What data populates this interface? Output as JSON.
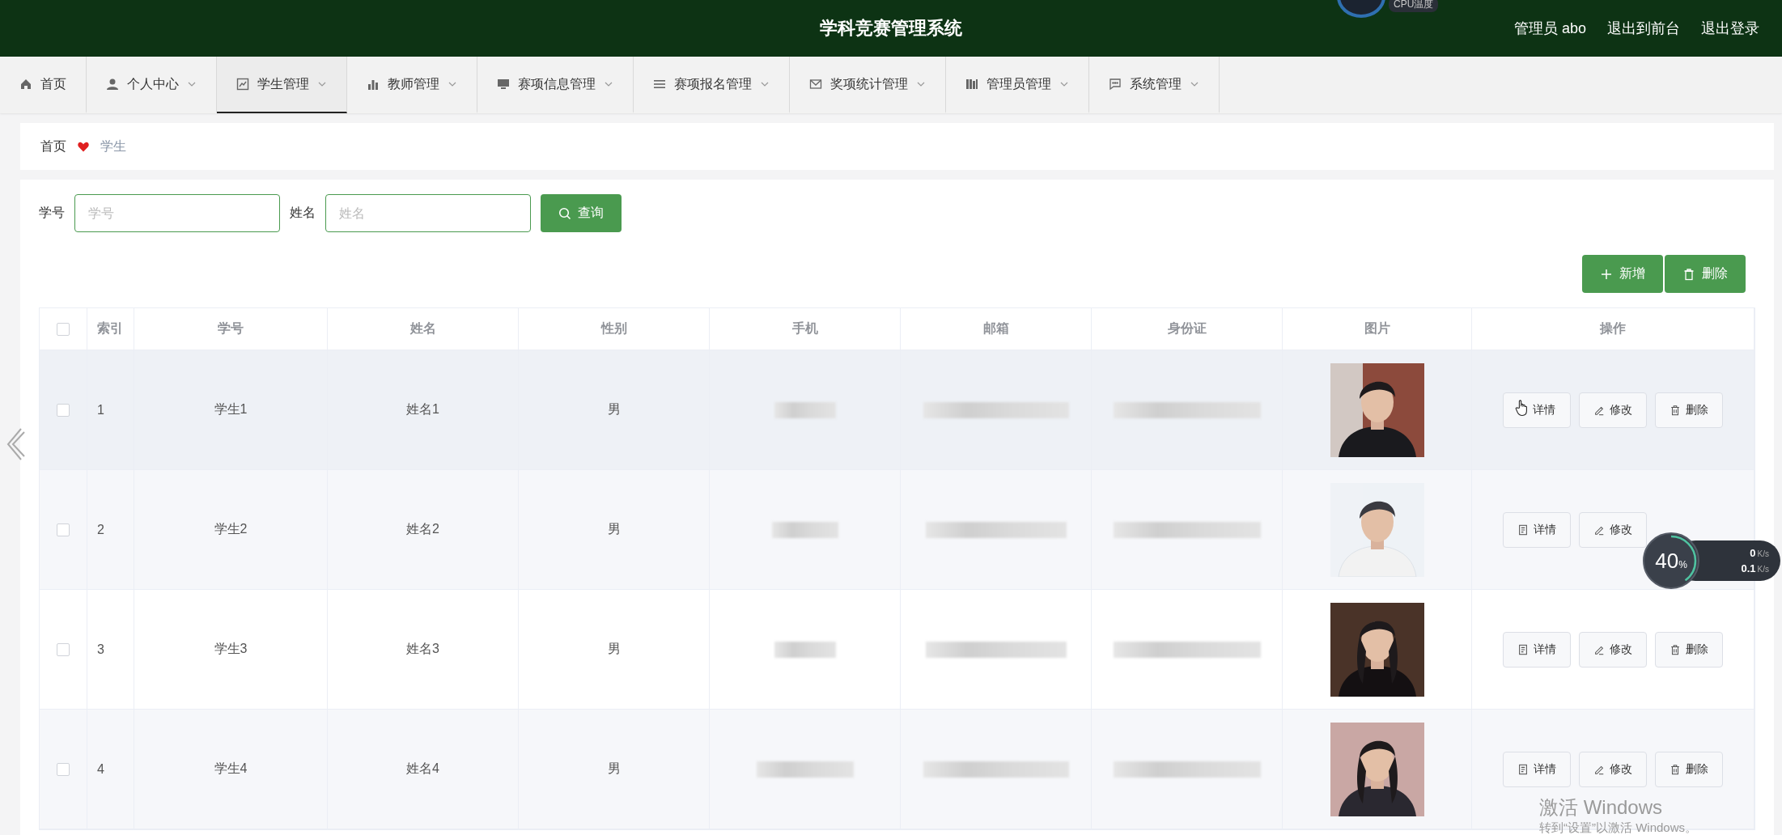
{
  "header": {
    "title": "学科竞赛管理系统",
    "user": "管理员 abo",
    "links": [
      "退出到前台",
      "退出登录"
    ]
  },
  "cpu_widget": {
    "label": "CPU温度"
  },
  "nav": [
    {
      "label": "首页",
      "dropdown": false,
      "selected": false
    },
    {
      "label": "个人中心",
      "dropdown": true,
      "selected": false
    },
    {
      "label": "学生管理",
      "dropdown": true,
      "selected": true
    },
    {
      "label": "教师管理",
      "dropdown": true,
      "selected": false
    },
    {
      "label": "赛项信息管理",
      "dropdown": true,
      "selected": false
    },
    {
      "label": "赛项报名管理",
      "dropdown": true,
      "selected": false
    },
    {
      "label": "奖项统计管理",
      "dropdown": true,
      "selected": false
    },
    {
      "label": "管理员管理",
      "dropdown": true,
      "selected": false
    },
    {
      "label": "系统管理",
      "dropdown": true,
      "selected": false
    }
  ],
  "breadcrumb": {
    "home": "首页",
    "current": "学生"
  },
  "search": {
    "fields": [
      {
        "label": "学号",
        "placeholder": "学号"
      },
      {
        "label": "姓名",
        "placeholder": "姓名"
      }
    ],
    "button": "查询"
  },
  "actions": [
    {
      "kind": "add",
      "label": "新增"
    },
    {
      "kind": "delete",
      "label": "删除"
    }
  ],
  "table": {
    "all_checked": false,
    "columns": [
      "索引",
      "学号",
      "姓名",
      "性别",
      "手机",
      "邮箱",
      "身份证",
      "图片",
      "操作"
    ],
    "rows": [
      {
        "index": "1",
        "student_id": "学生1",
        "name": "姓名1",
        "gender": "男",
        "checked": false,
        "hovered": true,
        "buttons": [
          {
            "kind": "detail",
            "label": "详情"
          },
          {
            "kind": "edit",
            "label": "修改"
          },
          {
            "kind": "delete",
            "label": "删除"
          }
        ]
      },
      {
        "index": "2",
        "student_id": "学生2",
        "name": "姓名2",
        "gender": "男",
        "checked": false,
        "hovered": false,
        "buttons": [
          {
            "kind": "detail",
            "label": "详情"
          },
          {
            "kind": "edit",
            "label": "修改"
          }
        ]
      },
      {
        "index": "3",
        "student_id": "学生3",
        "name": "姓名3",
        "gender": "男",
        "checked": false,
        "hovered": false,
        "buttons": [
          {
            "kind": "detail",
            "label": "详情"
          },
          {
            "kind": "edit",
            "label": "修改"
          },
          {
            "kind": "delete",
            "label": "删除"
          }
        ]
      },
      {
        "index": "4",
        "student_id": "学生4",
        "name": "姓名4",
        "gender": "男",
        "checked": false,
        "hovered": false,
        "buttons": [
          {
            "kind": "detail",
            "label": "详情"
          },
          {
            "kind": "edit",
            "label": "修改"
          },
          {
            "kind": "delete",
            "label": "删除"
          }
        ]
      }
    ]
  },
  "net_widget": {
    "percent": "40",
    "unit": "%",
    "level": 0.4,
    "up": "0",
    "up_unit": "K/s",
    "down": "0.1",
    "down_unit": "K/s"
  },
  "activation": {
    "title": "激活 Windows",
    "hint": "转到“设置”以激活 Windows。"
  }
}
